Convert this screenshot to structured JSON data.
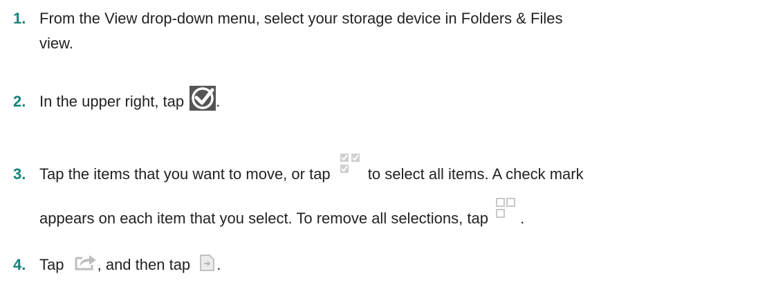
{
  "steps": [
    {
      "number": "1.",
      "line1": "From the View drop-down menu, select your storage device in Folders & Files",
      "line2": "view."
    },
    {
      "number": "2.",
      "before_icon": "In the upper right, tap",
      "after_icon": ".",
      "icon": "check-circle-icon"
    },
    {
      "number": "3.",
      "line1_before": "Tap the items that you want to move, or tap",
      "line1_after": "to select all items. A check mark",
      "line2_before": "appears on each item that you select. To remove all selections, tap",
      "line2_after": ".",
      "icons": [
        "select-all-icon",
        "deselect-all-icon"
      ]
    },
    {
      "number": "4.",
      "text1": "Tap",
      "text2": ", and then tap",
      "text3": ".",
      "icons": [
        "share-icon",
        "move-file-icon"
      ]
    }
  ],
  "colors": {
    "step_number": "#12837b",
    "body_text": "#222222",
    "icon_gray": "#c8c8c8",
    "icon_dark": "#444444"
  }
}
